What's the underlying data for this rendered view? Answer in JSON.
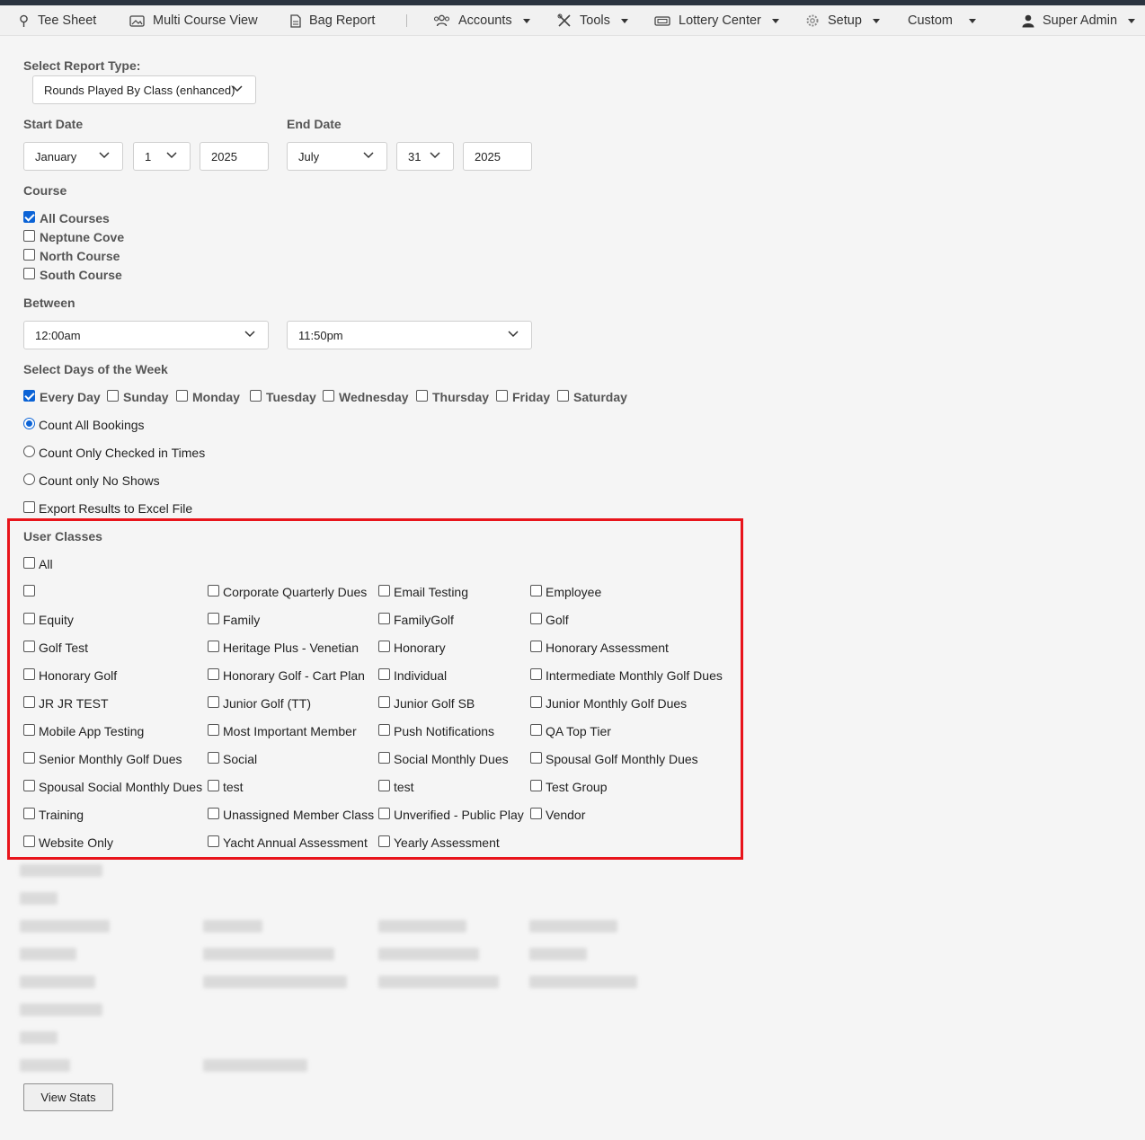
{
  "nav": {
    "tee_sheet": "Tee Sheet",
    "multi_course": "Multi Course View",
    "bag_report": "Bag Report",
    "accounts": "Accounts",
    "tools": "Tools",
    "lottery": "Lottery Center",
    "setup": "Setup",
    "custom": "Custom",
    "user": "Super Admin"
  },
  "report": {
    "type_label": "Select Report Type:",
    "type_value": "Rounds Played By Class (enhanced)"
  },
  "dates": {
    "start_label": "Start Date",
    "start_month": "January",
    "start_day": "1",
    "start_year": "2025",
    "end_label": "End Date",
    "end_month": "July",
    "end_day": "31",
    "end_year": "2025"
  },
  "course": {
    "label": "Course",
    "options": [
      {
        "label": "All Courses",
        "checked": true
      },
      {
        "label": "Neptune Cove",
        "checked": false
      },
      {
        "label": "North Course",
        "checked": false
      },
      {
        "label": "South Course",
        "checked": false
      }
    ]
  },
  "between": {
    "label": "Between",
    "from": "12:00am",
    "to": "11:50pm"
  },
  "days": {
    "label": "Select Days of the Week",
    "options": [
      {
        "label": "Every Day",
        "checked": true
      },
      {
        "label": "Sunday",
        "checked": false
      },
      {
        "label": "Monday",
        "checked": false
      },
      {
        "label": "Tuesday",
        "checked": false
      },
      {
        "label": "Wednesday",
        "checked": false
      },
      {
        "label": "Thursday",
        "checked": false
      },
      {
        "label": "Friday",
        "checked": false
      },
      {
        "label": "Saturday",
        "checked": false
      }
    ]
  },
  "count": {
    "options": [
      {
        "label": "Count All Bookings",
        "checked": true
      },
      {
        "label": "Count Only Checked in Times",
        "checked": false
      },
      {
        "label": "Count only No Shows",
        "checked": false
      }
    ]
  },
  "export": {
    "label": "Export Results to Excel File",
    "checked": false
  },
  "user_classes": {
    "label": "User Classes",
    "all_label": "All",
    "items": [
      "",
      "Corporate Quarterly Dues",
      "Email Testing",
      "Employee",
      "Equity",
      "Family",
      "FamilyGolf",
      "Golf",
      "Golf Test",
      "Heritage Plus - Venetian",
      "Honorary",
      "Honorary Assessment",
      "Honorary Golf",
      "Honorary Golf - Cart Plan",
      "Individual",
      "Intermediate Monthly Golf Dues",
      "JR JR TEST",
      "Junior Golf (TT)",
      "Junior Golf SB",
      "Junior Monthly Golf Dues",
      "Mobile App Testing",
      "Most Important Member",
      "Push Notifications",
      "QA Top Tier",
      "Senior Monthly Golf Dues",
      "Social",
      "Social Monthly Dues",
      "Spousal Golf Monthly Dues",
      "Spousal Social Monthly Dues",
      "test",
      "test",
      "Test Group",
      "Training",
      "Unassigned Member Class",
      "Unverified - Public Play",
      "Vendor",
      "Website Only",
      "Yacht Annual Assessment",
      "Yearly Assessment"
    ]
  },
  "actions": {
    "view_stats": "View Stats"
  }
}
